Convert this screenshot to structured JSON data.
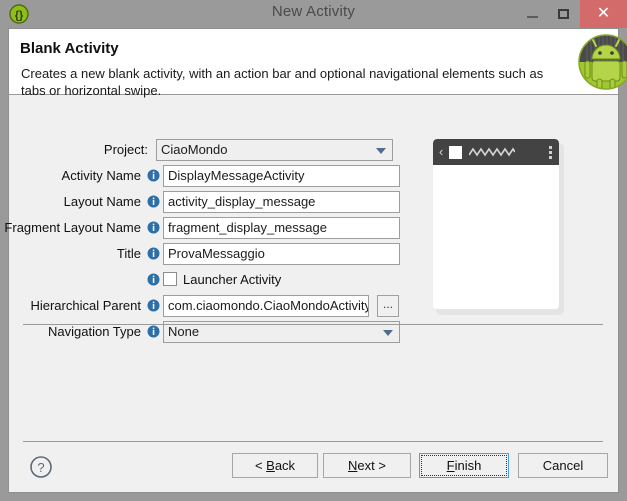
{
  "window": {
    "title": "New Activity",
    "app_icon": "braces-icon",
    "controls": {
      "minimize": "minimize-button",
      "maximize": "maximize-button",
      "close_glyph": "✕"
    }
  },
  "header": {
    "title": "Blank Activity",
    "description": "Creates a new blank activity, with an action bar and optional navigational elements such as tabs or horizontal swipe.",
    "logo": "android-robot-icon"
  },
  "form": {
    "fields": [
      {
        "label": "Project:",
        "value": "CiaoMondo",
        "type": "combobox",
        "has_info": false,
        "name": "project"
      },
      {
        "label": "Activity Name",
        "value": "DisplayMessageActivity",
        "type": "text",
        "has_info": true,
        "name": "activity-name"
      },
      {
        "label": "Layout Name",
        "value": "activity_display_message",
        "type": "text",
        "has_info": true,
        "name": "layout-name"
      },
      {
        "label": "Fragment Layout Name",
        "value": "fragment_display_message",
        "type": "text",
        "has_info": true,
        "name": "fragment-layout-name"
      },
      {
        "label": "Title",
        "value": "ProvaMessaggio",
        "type": "text",
        "has_info": true,
        "name": "title"
      }
    ],
    "launcher_checkbox": {
      "label": "Launcher Activity",
      "checked": false,
      "has_info": true
    },
    "hierarchical_parent": {
      "label": "Hierarchical Parent",
      "value": "com.ciaomondo.CiaoMondoActivity",
      "browse_label": "...",
      "has_info": true
    },
    "navigation_type": {
      "label": "Navigation Type",
      "value": "None",
      "type": "combobox",
      "has_info": true
    }
  },
  "preview": {
    "back_glyph": "‹",
    "app_icon": "app-square-icon",
    "title_placeholder": "zigzag-title-placeholder",
    "overflow": "overflow-menu-icon"
  },
  "buttonbar": {
    "help": "help-icon",
    "buttons": [
      {
        "name": "back",
        "label_before": "< ",
        "mnemonic": "B",
        "label_after": "ack"
      },
      {
        "name": "next",
        "label_before": "",
        "mnemonic": "N",
        "label_after": "ext >"
      },
      {
        "name": "finish",
        "label_before": "",
        "mnemonic": "F",
        "label_after": "inish"
      },
      {
        "name": "cancel",
        "label_before": "",
        "mnemonic": "",
        "label_after": "Cancel"
      }
    ],
    "back_label": "< Back",
    "next_label": "Next >",
    "finish_label": "Finish",
    "cancel_label": "Cancel"
  },
  "colors": {
    "frame": "#9a9a9a",
    "dialog_bg": "#f0f0f0",
    "close_red": "#d36b6b",
    "focus_blue": "#4a9fe0",
    "android_green": "#a4c639",
    "actionbar_dark": "#434343"
  }
}
